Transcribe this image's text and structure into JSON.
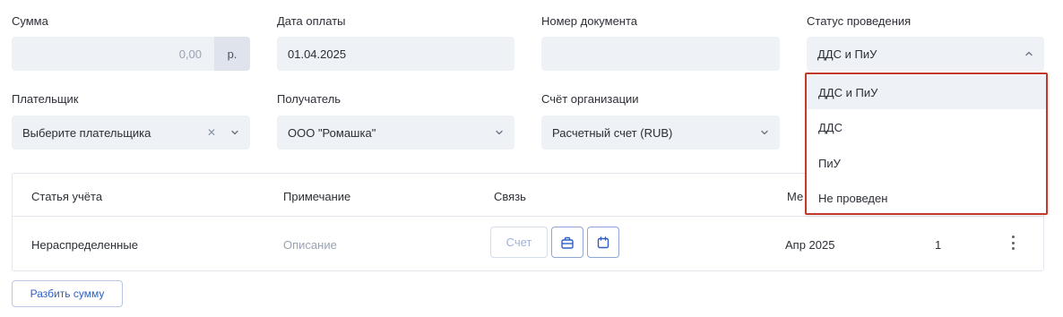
{
  "labels": {
    "amount": "Сумма",
    "pay_date": "Дата оплаты",
    "doc_number": "Номер документа",
    "status": "Статус проведения",
    "payer": "Плательщик",
    "recipient": "Получатель",
    "org_account": "Счёт организации"
  },
  "fields": {
    "amount_value": "0,00",
    "currency": "р.",
    "pay_date_value": "01.04.2025",
    "doc_number_value": "",
    "status_value": "ДДС и ПиУ",
    "payer_placeholder": "Выберите плательщика",
    "recipient_value": "ООО \"Ромашка\"",
    "org_account_value": "Расчетный счет (RUB)"
  },
  "table": {
    "headers": [
      "Статья учёта",
      "Примечание",
      "Связь",
      "Ме"
    ],
    "row": {
      "article": "Нераспределенные",
      "note": "Описание",
      "link_button": "Счет",
      "month": "Апр 2025",
      "count": "1"
    }
  },
  "split_button": "Разбить сумму",
  "dropdown": {
    "options": [
      "ДДС и ПиУ",
      "ДДС",
      "ПиУ",
      "Не проведен"
    ],
    "selected_index": 0
  },
  "colors": {
    "field_bg": "#eef1f6",
    "accent": "#2f5fc4",
    "highlight_border": "#c0392b"
  }
}
